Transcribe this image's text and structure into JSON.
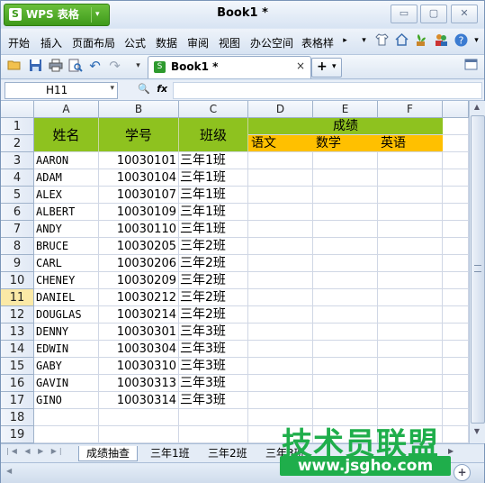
{
  "app": {
    "name": "WPS 表格",
    "logo": "S",
    "dropdown": "▾"
  },
  "window": {
    "title": "Book1 *",
    "controls": [
      "▭",
      "▢",
      "✕"
    ]
  },
  "menu": {
    "items": [
      "开始",
      "插入",
      "页面布局",
      "公式",
      "数据",
      "审阅",
      "视图",
      "办公空间",
      "表格样"
    ]
  },
  "tab": {
    "doc_name": "Book1 *",
    "close": "×",
    "new_tab": "+",
    "new_tab_arrow": "▾"
  },
  "formula_bar": {
    "name_box": "H11",
    "fx": "fx",
    "value": ""
  },
  "columns": [
    "A",
    "B",
    "C",
    "D",
    "E",
    "F"
  ],
  "rows": [
    "1",
    "2",
    "3",
    "4",
    "5",
    "6",
    "7",
    "8",
    "9",
    "10",
    "11",
    "12",
    "13",
    "14",
    "15",
    "16",
    "17",
    "18",
    "19"
  ],
  "selected_row": "11",
  "headers": {
    "name": "姓名",
    "id": "学号",
    "class": "班级",
    "score": "成绩",
    "chinese": "语文",
    "math": "数学",
    "english": "英语"
  },
  "records": [
    {
      "name": "AARON",
      "id": "10030101",
      "cls": "三年1班"
    },
    {
      "name": "ADAM",
      "id": "10030104",
      "cls": "三年1班"
    },
    {
      "name": "ALEX",
      "id": "10030107",
      "cls": "三年1班"
    },
    {
      "name": "ALBERT",
      "id": "10030109",
      "cls": "三年1班"
    },
    {
      "name": "ANDY",
      "id": "10030110",
      "cls": "三年1班"
    },
    {
      "name": "BRUCE",
      "id": "10030205",
      "cls": "三年2班"
    },
    {
      "name": "CARL",
      "id": "10030206",
      "cls": "三年2班"
    },
    {
      "name": "CHENEY",
      "id": "10030209",
      "cls": "三年2班"
    },
    {
      "name": "DANIEL",
      "id": "10030212",
      "cls": "三年2班"
    },
    {
      "name": "DOUGLAS",
      "id": "10030214",
      "cls": "三年2班"
    },
    {
      "name": "DENNY",
      "id": "10030301",
      "cls": "三年3班"
    },
    {
      "name": "EDWIN",
      "id": "10030304",
      "cls": "三年3班"
    },
    {
      "name": "GABY",
      "id": "10030310",
      "cls": "三年3班"
    },
    {
      "name": "GAVIN",
      "id": "10030313",
      "cls": "三年3班"
    },
    {
      "name": "GINO",
      "id": "10030314",
      "cls": "三年3班"
    }
  ],
  "sheet_tabs": [
    "成绩抽查",
    "三年1班",
    "三年2班",
    "三年3班"
  ],
  "watermark": {
    "line1": "技术员联盟",
    "line2": "www.jsgho.com"
  },
  "colors": {
    "header_green": "#8ec21f",
    "subheader_yellow": "#ffc000",
    "brand_green": "#3e9a1b",
    "selected_row": "#fbe9a6"
  },
  "icons": {
    "menu_right": [
      "more-arrow-icon",
      "chevron-down-icon",
      "shirt-icon",
      "home-icon",
      "plant-icon",
      "users-icon",
      "help-icon",
      "chevron-down-icon"
    ],
    "toolbar": [
      "open-icon",
      "save-icon",
      "print-icon",
      "preview-icon",
      "undo-icon",
      "redo-icon",
      "customize-icon",
      "window-icon"
    ]
  }
}
